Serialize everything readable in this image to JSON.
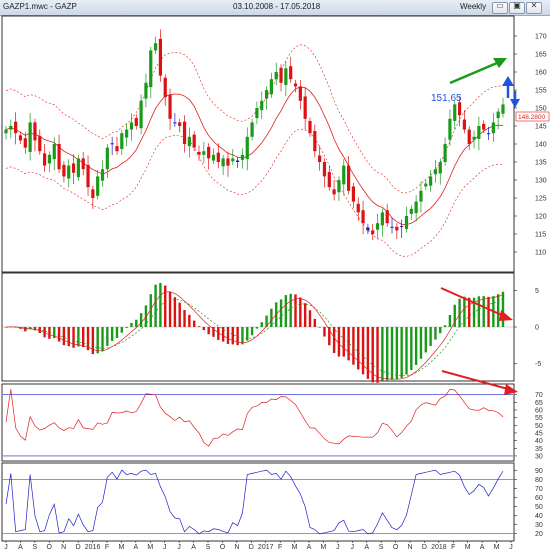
{
  "window": {
    "symbol_title": "GAZP1.mwc - GAZP",
    "date_range": "03.10.2008 - 17.05.2018",
    "timeframe": "Weekly",
    "buttons": [
      {
        "name": "minimize-button",
        "glyph": "▭"
      },
      {
        "name": "restore-button",
        "glyph": "▣"
      },
      {
        "name": "close-button",
        "glyph": "✕"
      }
    ]
  },
  "price_panel": {
    "y_ticks": [
      "170",
      "165",
      "160",
      "155",
      "150",
      "145",
      "140",
      "135",
      "130",
      "125",
      "120",
      "115",
      "110"
    ],
    "annotation": "151,65",
    "last_price": "148.2800",
    "colors": {
      "up": "#1a9a1a",
      "down": "#dd1111",
      "flat": "#1a1acc",
      "envelope": "#e02020",
      "ma": "#e02020"
    }
  },
  "macd_panel": {
    "y_ticks": [
      "5",
      "0",
      "-5"
    ]
  },
  "rsi_panel": {
    "y_ticks": [
      "70",
      "65",
      "60",
      "55",
      "50",
      "45",
      "40",
      "35",
      "30"
    ],
    "color": "#e02020"
  },
  "stoch_panel": {
    "y_ticks": [
      "90",
      "80",
      "70",
      "60",
      "50",
      "40",
      "30",
      "20"
    ],
    "color": "#2020cc"
  },
  "x_axis": {
    "labels": [
      "J",
      "A",
      "S",
      "O",
      "N",
      "D",
      "2016",
      "F",
      "M",
      "A",
      "M",
      "J",
      "J",
      "A",
      "S",
      "O",
      "N",
      "D",
      "2017",
      "F",
      "M",
      "A",
      "M",
      "J",
      "J",
      "A",
      "S",
      "O",
      "N",
      "D",
      "2018",
      "F",
      "M",
      "A",
      "M",
      "J"
    ]
  },
  "arrows": {
    "green": "#1a9a1a",
    "blue": "#2255dd",
    "red": "#e02020"
  },
  "chart_data": {
    "type": "candlestick",
    "price_range": [
      105,
      175
    ],
    "prices": [
      144,
      145,
      143,
      141,
      139,
      146,
      141,
      138,
      134,
      137,
      140,
      133,
      131,
      134,
      132,
      136,
      133,
      128,
      125,
      131,
      133,
      139,
      140,
      138,
      143,
      144,
      146,
      145,
      152,
      157,
      166,
      168,
      159,
      153,
      147,
      146,
      145,
      140,
      142,
      139,
      137,
      138,
      136,
      137,
      135,
      136,
      134,
      136,
      135,
      137,
      142,
      146,
      150,
      152,
      155,
      158,
      160,
      157,
      161,
      158,
      156,
      152,
      147,
      143,
      138,
      135,
      131,
      128,
      126,
      130,
      134,
      127,
      124,
      121,
      118,
      116,
      115,
      118,
      121,
      118,
      117,
      116,
      117,
      120,
      122,
      124,
      127,
      129,
      131,
      133,
      135,
      140,
      147,
      151,
      148,
      144,
      140,
      142,
      145,
      144,
      143,
      146,
      149,
      151
    ],
    "macd_range": [
      -7,
      7
    ],
    "rsi_range": [
      28,
      75
    ],
    "rsi_levels": [
      70,
      30
    ],
    "stoch_range": [
      15,
      95
    ],
    "stoch_levels": [
      80,
      20
    ]
  }
}
